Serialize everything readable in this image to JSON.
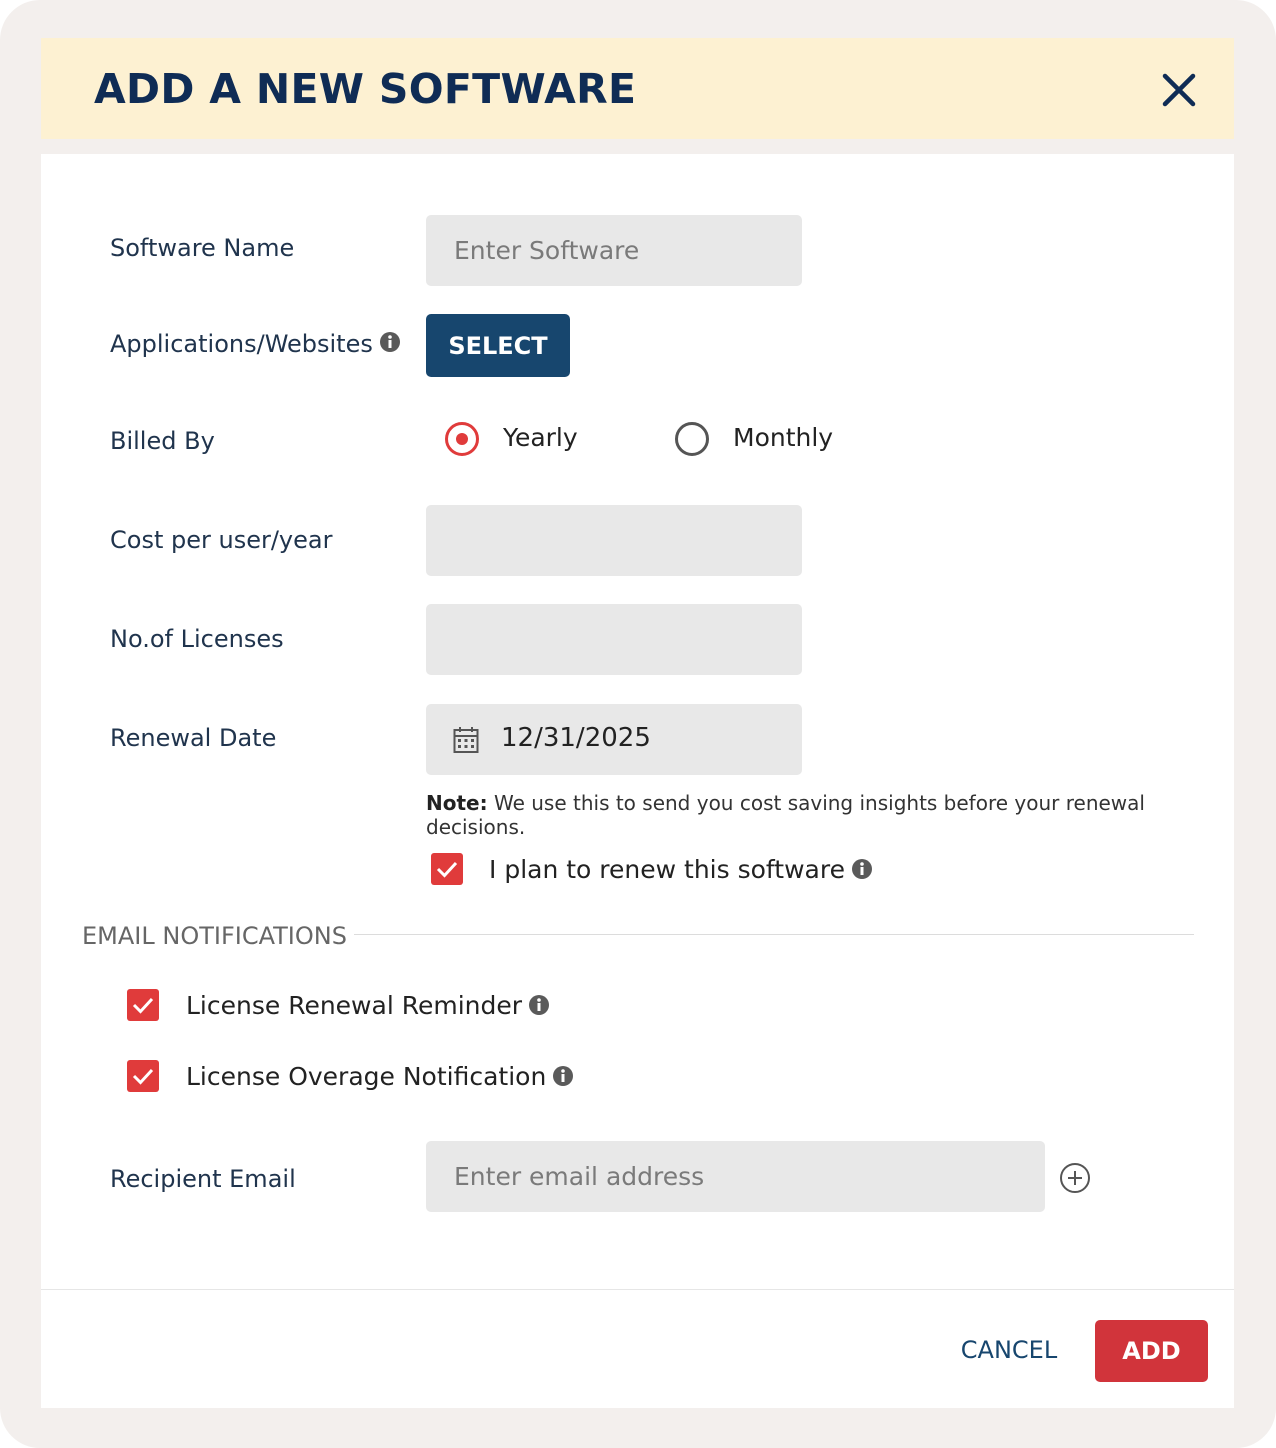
{
  "dialog": {
    "title": "ADD A NEW SOFTWARE",
    "close_icon": "close-icon"
  },
  "form": {
    "software_name": {
      "label": "Software Name",
      "placeholder": "Enter Software",
      "value": ""
    },
    "applications": {
      "label": "Applications/Websites",
      "button_label": "SELECT"
    },
    "billed_by": {
      "label": "Billed By",
      "options": [
        {
          "label": "Yearly",
          "selected": true
        },
        {
          "label": "Monthly",
          "selected": false
        }
      ]
    },
    "cost": {
      "label": "Cost per user/year",
      "value": ""
    },
    "licenses": {
      "label": "No.of Licenses",
      "value": ""
    },
    "renewal_date": {
      "label": "Renewal Date",
      "value": "12/31/2025",
      "note_prefix": "Note:",
      "note_text": " We use this to send you cost saving insights before your renewal decisions."
    },
    "plan_to_renew": {
      "label": "I plan to renew this software",
      "checked": true
    }
  },
  "email_notifications": {
    "section_title": "EMAIL NOTIFICATIONS",
    "items": [
      {
        "label": "License Renewal Reminder",
        "checked": true
      },
      {
        "label": "License Overage Notification",
        "checked": true
      }
    ],
    "recipient": {
      "label": "Recipient Email",
      "placeholder": "Enter email address",
      "value": ""
    }
  },
  "footer": {
    "cancel_label": "CANCEL",
    "add_label": "ADD"
  },
  "colors": {
    "header_bg": "#fdf1d2",
    "title": "#0f2c55",
    "primary_button": "#17466e",
    "accent_red": "#e03b3b",
    "add_button": "#d1343b"
  }
}
